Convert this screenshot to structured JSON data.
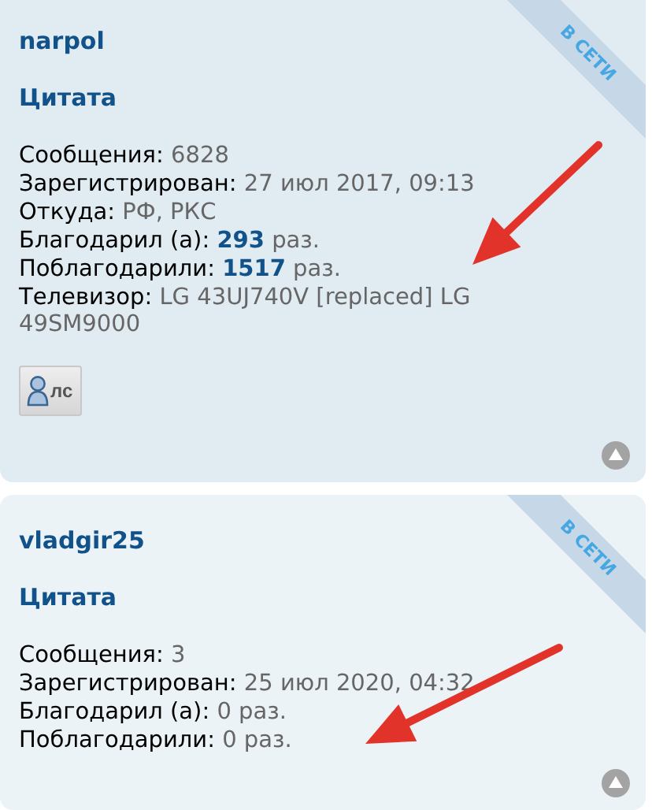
{
  "posts": [
    {
      "username": "narpol",
      "ribbon": "В СЕТИ",
      "quote": "Цитата",
      "stats": [
        {
          "label": "Сообщения:",
          "value": "6828"
        },
        {
          "label": "Зарегистрирован:",
          "value": "27 июл 2017, 09:13"
        },
        {
          "label": "Откуда:",
          "value": "РФ, РКС"
        },
        {
          "label": "Благодарил (а):",
          "value": "**293** раз."
        },
        {
          "label": "Поблагодарили:",
          "value": "**1517** раз."
        },
        {
          "label": "Телевизор:",
          "value": "LG 43UJ740V [replaced] LG 49SM9000"
        }
      ],
      "pm_button": "лс"
    },
    {
      "username": "vladgir25",
      "ribbon": "В СЕТИ",
      "quote": "Цитата",
      "stats": [
        {
          "label": "Сообщения:",
          "value": "3"
        },
        {
          "label": "Зарегистрирован:",
          "value": "25 июл 2020, 04:32"
        },
        {
          "label": "Благодарил (а):",
          "value": "0 раз."
        },
        {
          "label": "Поблагодарили:",
          "value": "0 раз."
        }
      ]
    }
  ]
}
